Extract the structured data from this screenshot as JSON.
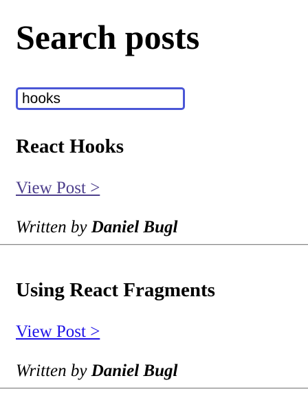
{
  "page": {
    "title": "Search posts"
  },
  "search": {
    "value": "hooks"
  },
  "posts": [
    {
      "title": "React Hooks",
      "link_text": "View Post >",
      "byline_prefix": "Written by",
      "author": "Daniel Bugl"
    },
    {
      "title": "Using React Fragments",
      "link_text": "View Post >",
      "byline_prefix": "Written by",
      "author": "Daniel Bugl"
    }
  ],
  "colors": {
    "link_visited": "#4d3f8c",
    "link_unvisited": "#1d12e6",
    "focus_border": "#4a56d6"
  }
}
